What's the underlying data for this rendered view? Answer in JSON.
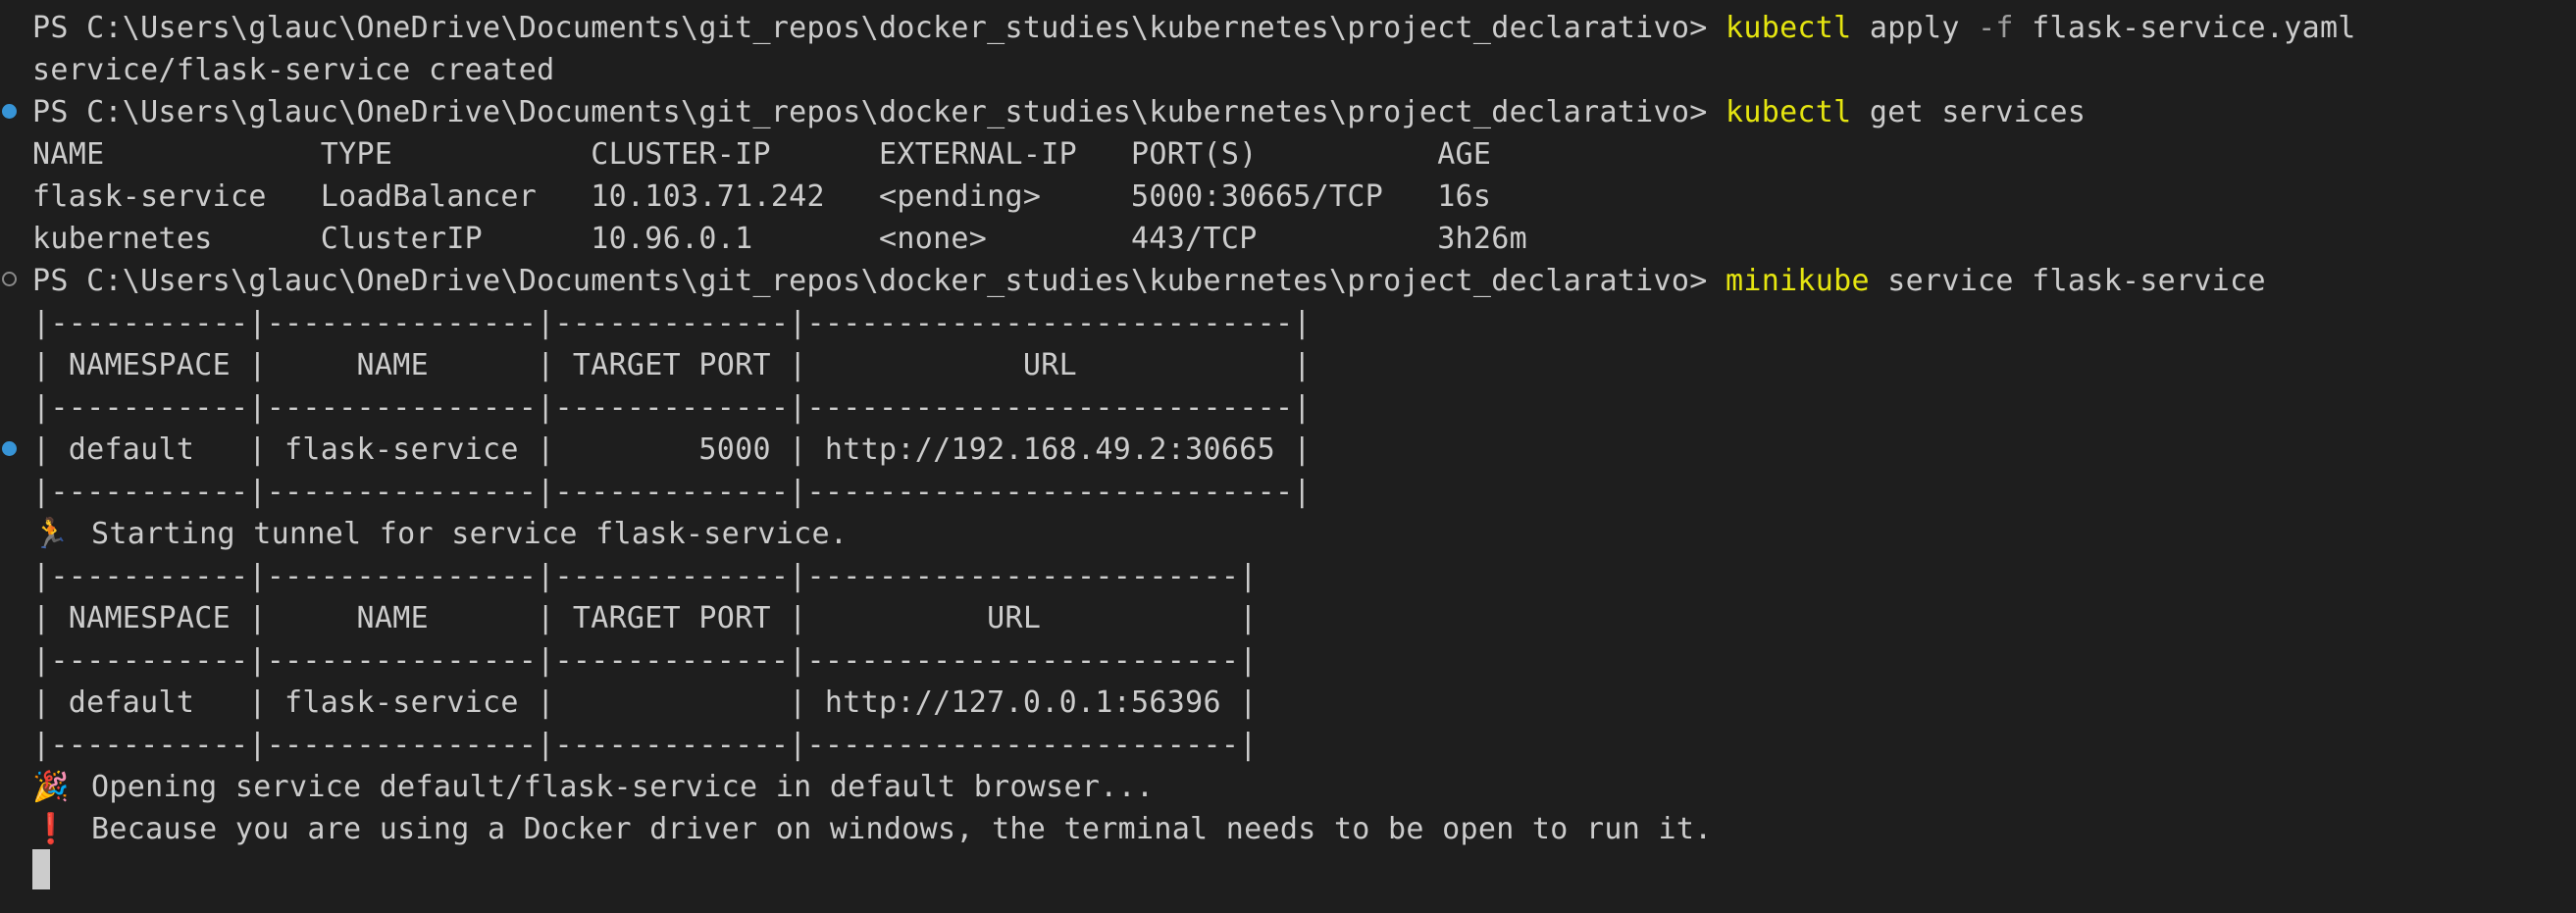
{
  "terminal": {
    "prompt": "PS C:\\Users\\glauc\\OneDrive\\Documents\\git_repos\\docker_studies\\kubernetes\\project_declarativo> ",
    "commands": [
      {
        "program": "kubectl",
        "flag": "-f",
        "apply": "apply ",
        "file": " flask-service.yaml"
      },
      {
        "program": "kubectl",
        "args": " get services"
      },
      {
        "program": "minikube",
        "args": " service flask-service"
      }
    ],
    "outputs": {
      "apply_result": "service/flask-service created",
      "services_header": "NAME            TYPE           CLUSTER-IP      EXTERNAL-IP   PORT(S)          AGE",
      "services_rows": [
        "flask-service   LoadBalancer   10.103.71.242   <pending>     5000:30665/TCP   16s",
        "kubernetes      ClusterIP      10.96.0.1       <none>        443/TCP          3h26m"
      ],
      "table1": [
        "|-----------|---------------|-------------|---------------------------|",
        "| NAMESPACE |     NAME      | TARGET PORT |            URL            |",
        "|-----------|---------------|-------------|---------------------------|",
        "| default   | flask-service |        5000 | http://192.168.49.2:30665 |",
        "|-----------|---------------|-------------|---------------------------|"
      ],
      "tunnel_message": "Starting tunnel for service flask-service.",
      "table2": [
        "|-----------|---------------|-------------|------------------------|",
        "| NAMESPACE |     NAME      | TARGET PORT |          URL           |",
        "|-----------|---------------|-------------|------------------------|",
        "| default   | flask-service |             | http://127.0.0.1:56396 |",
        "|-----------|---------------|-------------|------------------------|"
      ],
      "opening_message": "Opening service default/flask-service in default browser...",
      "warning_message": "Because you are using a Docker driver on windows, the terminal needs to be open to run it."
    },
    "icons": {
      "runner": "🏃",
      "party": "🎉",
      "exclamation": "❗"
    },
    "colors": {
      "background": "#1e1e1e",
      "text": "#cccccc",
      "command": "#e5e510",
      "decoration_success": "#3794d6",
      "decoration_default": "#8a8a8a"
    }
  }
}
